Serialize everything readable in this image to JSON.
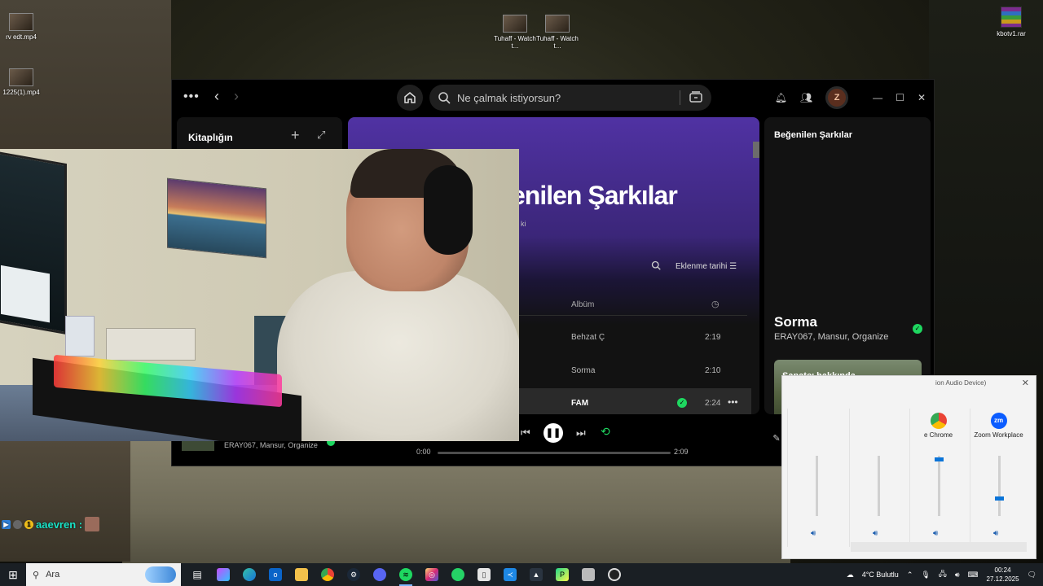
{
  "desktop": {
    "icons_left": [
      "rv edt.mp4",
      "1225(1).mp4"
    ],
    "icons_top": [
      "Tuhaff - Watch t...",
      "Tuhaff - Watch t..."
    ],
    "icon_right": "kbotv1.rar"
  },
  "spotify": {
    "search_placeholder": "Ne çalmak istiyorsun?",
    "avatar_letter": "Z",
    "library_title": "Kitaplığın",
    "hero_title": "enilen Şarkılar",
    "hero_subtitle": "ki",
    "sort_label": "Eklenme tarihi",
    "column_album": "Albüm",
    "rows": [
      {
        "album": "Behzat Ç",
        "duration": "2:19"
      },
      {
        "album": "Sorma",
        "duration": "2:10"
      },
      {
        "album": "FAM",
        "duration": "2:24"
      }
    ],
    "side_title": "Beğenilen Şarkılar",
    "now_playing_title": "Sorma",
    "now_playing_artists": "ERAY067, Mansur, Organize",
    "artist_card_label": "Sanatçı hakkında",
    "player": {
      "artists": "ERAY067, Mansur, Organize",
      "time_current": "0:00",
      "time_total": "2:09",
      "progress": 0,
      "volume": 0.3
    }
  },
  "chat": {
    "username": "aaevren :"
  },
  "mixer": {
    "title": "ion Audio Device)",
    "apps": [
      {
        "label": "",
        "level": 0
      },
      {
        "label": "",
        "level": 0
      },
      {
        "label": "e Chrome",
        "level": 0.95
      },
      {
        "label": "Zoom Workplace",
        "level": 0.3
      }
    ],
    "zoom_icon_text": "zm"
  },
  "taskbar": {
    "search_label": "Ara",
    "weather": "4°C Bulutlu",
    "time": "00:24",
    "date": "27.12.2025"
  },
  "colors": {
    "spotify_green": "#1ed760",
    "spotify_purple": "#5032a3",
    "windows_blue": "#0a74d8"
  }
}
